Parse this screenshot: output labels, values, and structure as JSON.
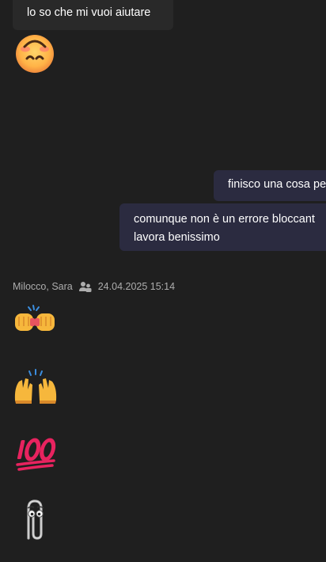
{
  "messages_top": {
    "incoming_text": "lo so che mi vuoi aiutare",
    "incoming_emoji_icon": "upside-down-face-emoji-icon"
  },
  "outgoing": {
    "message_1": "finisco una cosa pe",
    "message_2_line1": "comunque non è un errore bloccant",
    "message_2_line2": "lavora benissimo"
  },
  "sender_header": {
    "name": "Milocco, Sara",
    "status_icon": "people-presence-icon",
    "timestamp": "24.04.2025 15:14"
  },
  "emoji_messages": [
    {
      "icon": "fist-bump-emoji-icon"
    },
    {
      "icon": "raised-hands-emoji-icon"
    },
    {
      "icon": "hundred-points-emoji-icon"
    },
    {
      "icon": "paperclip-clippy-emoji-icon"
    }
  ],
  "colors": {
    "background": "#1f1f1f",
    "incoming_bubble": "#292929",
    "outgoing_bubble": "#2b2b40",
    "meta_text": "#adadad"
  }
}
